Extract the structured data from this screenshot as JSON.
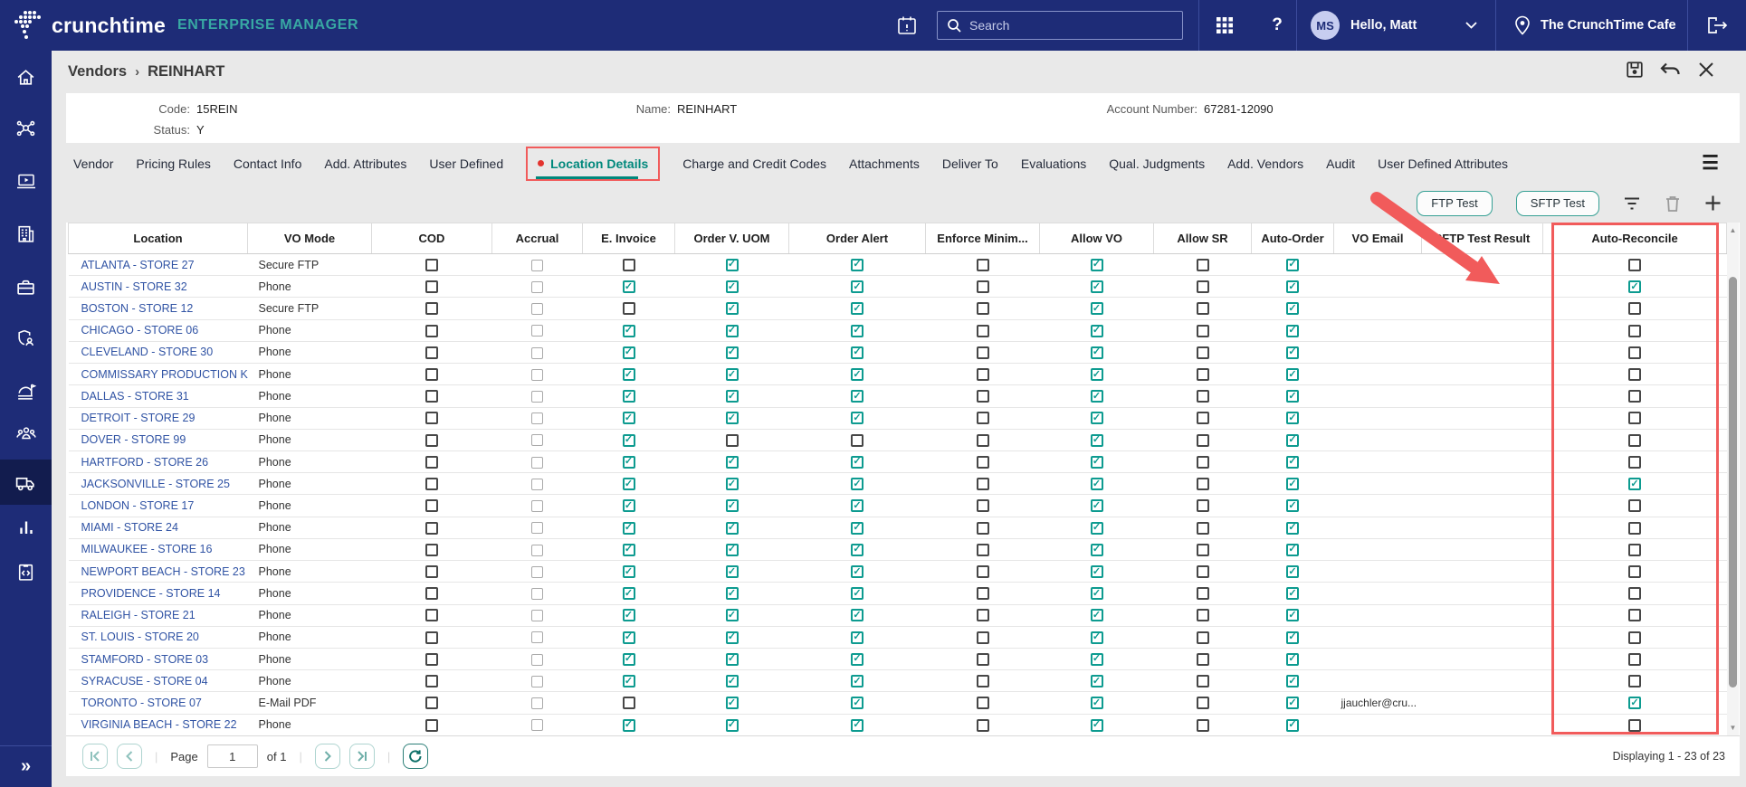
{
  "topbar": {
    "brand_primary": "crunchtime",
    "brand_secondary": "ENTERPRISE MANAGER",
    "search_placeholder": "Search",
    "help_label": "?",
    "user_initials": "MS",
    "user_greeting": "Hello, Matt",
    "location_name": "The CrunchTime Cafe"
  },
  "sidebar": {
    "icons": [
      "home-icon",
      "hub-icon",
      "laptop-play-icon",
      "building-icon",
      "briefcase-icon",
      "shield-user-icon",
      "food-menu-icon",
      "people-icon",
      "truck-icon",
      "bar-chart-icon",
      "clipboard-code-icon"
    ],
    "active_index": 8
  },
  "page": {
    "breadcrumb_root": "Vendors",
    "breadcrumb_separator": "›",
    "breadcrumb_current": "REINHART"
  },
  "record": {
    "code_label": "Code:",
    "code": "15REIN",
    "status_label": "Status:",
    "status": "Y",
    "name_label": "Name:",
    "name": "REINHART",
    "account_label": "Account Number:",
    "account": "67281-12090"
  },
  "tabs": {
    "items": [
      "Vendor",
      "Pricing Rules",
      "Contact Info",
      "Add. Attributes",
      "User Defined",
      "Location Details",
      "Charge and Credit Codes",
      "Attachments",
      "Deliver To",
      "Evaluations",
      "Qual. Judgments",
      "Add. Vendors",
      "Audit",
      "User Defined Attributes"
    ],
    "active": "Location Details"
  },
  "toolbar": {
    "ftp_label": "FTP Test",
    "sftp_label": "SFTP Test"
  },
  "table": {
    "columns": [
      "Location",
      "VO Mode",
      "COD",
      "Accrual",
      "E. Invoice",
      "Order V. UOM",
      "Order Alert",
      "Enforce Minim...",
      "Allow VO",
      "Allow SR",
      "Auto-Order",
      "VO Email",
      "SFTP Test Result",
      "Auto-Reconcile"
    ],
    "flag_columns": [
      "COD",
      "Accrual",
      "E. Invoice",
      "Order V. UOM",
      "Order Alert",
      "Enforce Minim...",
      "Allow VO",
      "Allow SR",
      "Auto-Order"
    ],
    "rows": [
      {
        "location": "ATLANTA - STORE 27",
        "vo_mode": "Secure FTP",
        "flags": [
          0,
          0,
          0,
          1,
          1,
          0,
          1,
          0,
          1
        ],
        "vo_email": "",
        "sftp_test_result": "",
        "auto_reconcile": 0
      },
      {
        "location": "AUSTIN - STORE 32",
        "vo_mode": "Phone",
        "flags": [
          0,
          0,
          1,
          1,
          1,
          0,
          1,
          0,
          1
        ],
        "vo_email": "",
        "sftp_test_result": "",
        "auto_reconcile": 1
      },
      {
        "location": "BOSTON - STORE 12",
        "vo_mode": "Secure FTP",
        "flags": [
          0,
          0,
          0,
          1,
          1,
          0,
          1,
          0,
          1
        ],
        "vo_email": "",
        "sftp_test_result": "",
        "auto_reconcile": 0
      },
      {
        "location": "CHICAGO - STORE 06",
        "vo_mode": "Phone",
        "flags": [
          0,
          0,
          1,
          1,
          1,
          0,
          1,
          0,
          1
        ],
        "vo_email": "",
        "sftp_test_result": "",
        "auto_reconcile": 0
      },
      {
        "location": "CLEVELAND - STORE 30",
        "vo_mode": "Phone",
        "flags": [
          0,
          0,
          1,
          1,
          1,
          0,
          1,
          0,
          1
        ],
        "vo_email": "",
        "sftp_test_result": "",
        "auto_reconcile": 0
      },
      {
        "location": "COMMISSARY PRODUCTION KIT...",
        "vo_mode": "Phone",
        "flags": [
          0,
          0,
          1,
          1,
          1,
          0,
          1,
          0,
          1
        ],
        "vo_email": "",
        "sftp_test_result": "",
        "auto_reconcile": 0
      },
      {
        "location": "DALLAS - STORE 31",
        "vo_mode": "Phone",
        "flags": [
          0,
          0,
          1,
          1,
          1,
          0,
          1,
          0,
          1
        ],
        "vo_email": "",
        "sftp_test_result": "",
        "auto_reconcile": 0
      },
      {
        "location": "DETROIT - STORE 29",
        "vo_mode": "Phone",
        "flags": [
          0,
          0,
          1,
          1,
          1,
          0,
          1,
          0,
          1
        ],
        "vo_email": "",
        "sftp_test_result": "",
        "auto_reconcile": 0
      },
      {
        "location": "DOVER - STORE 99",
        "vo_mode": "Phone",
        "flags": [
          0,
          0,
          1,
          0,
          0,
          0,
          1,
          0,
          1
        ],
        "vo_email": "",
        "sftp_test_result": "",
        "auto_reconcile": 0
      },
      {
        "location": "HARTFORD - STORE 26",
        "vo_mode": "Phone",
        "flags": [
          0,
          0,
          1,
          1,
          1,
          0,
          1,
          0,
          1
        ],
        "vo_email": "",
        "sftp_test_result": "",
        "auto_reconcile": 0
      },
      {
        "location": "JACKSONVILLE - STORE 25",
        "vo_mode": "Phone",
        "flags": [
          0,
          0,
          1,
          1,
          1,
          0,
          1,
          0,
          1
        ],
        "vo_email": "",
        "sftp_test_result": "",
        "auto_reconcile": 1
      },
      {
        "location": "LONDON - STORE 17",
        "vo_mode": "Phone",
        "flags": [
          0,
          0,
          1,
          1,
          1,
          0,
          1,
          0,
          1
        ],
        "vo_email": "",
        "sftp_test_result": "",
        "auto_reconcile": 0
      },
      {
        "location": "MIAMI - STORE 24",
        "vo_mode": "Phone",
        "flags": [
          0,
          0,
          1,
          1,
          1,
          0,
          1,
          0,
          1
        ],
        "vo_email": "",
        "sftp_test_result": "",
        "auto_reconcile": 0
      },
      {
        "location": "MILWAUKEE - STORE 16",
        "vo_mode": "Phone",
        "flags": [
          0,
          0,
          1,
          1,
          1,
          0,
          1,
          0,
          1
        ],
        "vo_email": "",
        "sftp_test_result": "",
        "auto_reconcile": 0
      },
      {
        "location": "NEWPORT BEACH - STORE 23",
        "vo_mode": "Phone",
        "flags": [
          0,
          0,
          1,
          1,
          1,
          0,
          1,
          0,
          1
        ],
        "vo_email": "",
        "sftp_test_result": "",
        "auto_reconcile": 0
      },
      {
        "location": "PROVIDENCE - STORE 14",
        "vo_mode": "Phone",
        "flags": [
          0,
          0,
          1,
          1,
          1,
          0,
          1,
          0,
          1
        ],
        "vo_email": "",
        "sftp_test_result": "",
        "auto_reconcile": 0
      },
      {
        "location": "RALEIGH - STORE 21",
        "vo_mode": "Phone",
        "flags": [
          0,
          0,
          1,
          1,
          1,
          0,
          1,
          0,
          1
        ],
        "vo_email": "",
        "sftp_test_result": "",
        "auto_reconcile": 0
      },
      {
        "location": "ST. LOUIS - STORE 20",
        "vo_mode": "Phone",
        "flags": [
          0,
          0,
          1,
          1,
          1,
          0,
          1,
          0,
          1
        ],
        "vo_email": "",
        "sftp_test_result": "",
        "auto_reconcile": 0
      },
      {
        "location": "STAMFORD - STORE 03",
        "vo_mode": "Phone",
        "flags": [
          0,
          0,
          1,
          1,
          1,
          0,
          1,
          0,
          1
        ],
        "vo_email": "",
        "sftp_test_result": "",
        "auto_reconcile": 0
      },
      {
        "location": "SYRACUSE - STORE 04",
        "vo_mode": "Phone",
        "flags": [
          0,
          0,
          1,
          1,
          1,
          0,
          1,
          0,
          1
        ],
        "vo_email": "",
        "sftp_test_result": "",
        "auto_reconcile": 0
      },
      {
        "location": "TORONTO - STORE 07",
        "vo_mode": "E-Mail PDF",
        "flags": [
          0,
          0,
          0,
          1,
          1,
          0,
          1,
          0,
          1
        ],
        "vo_email": "jjauchler@cru...",
        "sftp_test_result": "",
        "auto_reconcile": 1
      },
      {
        "location": "VIRGINIA BEACH - STORE 22",
        "vo_mode": "Phone",
        "flags": [
          0,
          0,
          1,
          1,
          1,
          0,
          1,
          0,
          1
        ],
        "vo_email": "",
        "sftp_test_result": "",
        "auto_reconcile": 0
      }
    ]
  },
  "pagination": {
    "page_label": "Page",
    "page_value": "1",
    "of_label": "of 1",
    "displaying": "Displaying 1 - 23 of 23"
  },
  "colors": {
    "navy": "#1e2c77",
    "teal_check": "#0d9b90",
    "tab_teal": "#00887c",
    "link_blue": "#3053a4",
    "annotation_red": "#f15b5b"
  }
}
